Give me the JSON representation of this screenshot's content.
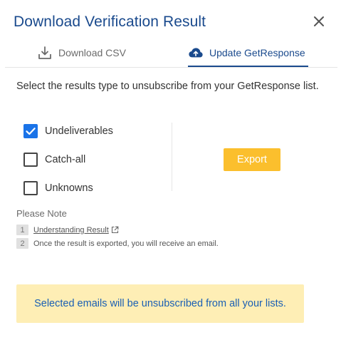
{
  "dialog": {
    "title": "Download Verification Result",
    "close_icon": "close-icon"
  },
  "tabs": [
    {
      "label": "Download CSV",
      "icon": "download-icon",
      "active": false
    },
    {
      "label": "Update GetResponse",
      "icon": "cloud-upload-icon",
      "active": true
    }
  ],
  "intro": "Select the results type to unsubscribe from your GetResponse list.",
  "options": [
    {
      "label": "Undeliverables",
      "checked": true
    },
    {
      "label": "Catch-all",
      "checked": false
    },
    {
      "label": "Unknowns",
      "checked": false
    }
  ],
  "export_label": "Export",
  "note": {
    "title": "Please Note",
    "items": [
      {
        "num": "1",
        "text": "Understanding Result",
        "is_link": true,
        "icon": "external-link-icon"
      },
      {
        "num": "2",
        "text": "Once the result is exported, you will receive an email.",
        "is_link": false
      }
    ]
  },
  "banner": "Selected emails will be unsubscribed from all your lists.",
  "colors": {
    "primary": "#1a4a8d",
    "checkbox": "#1a73e8",
    "export": "#fbbf2d",
    "banner_bg": "#feeeb5",
    "banner_text": "#1a5fb4"
  }
}
